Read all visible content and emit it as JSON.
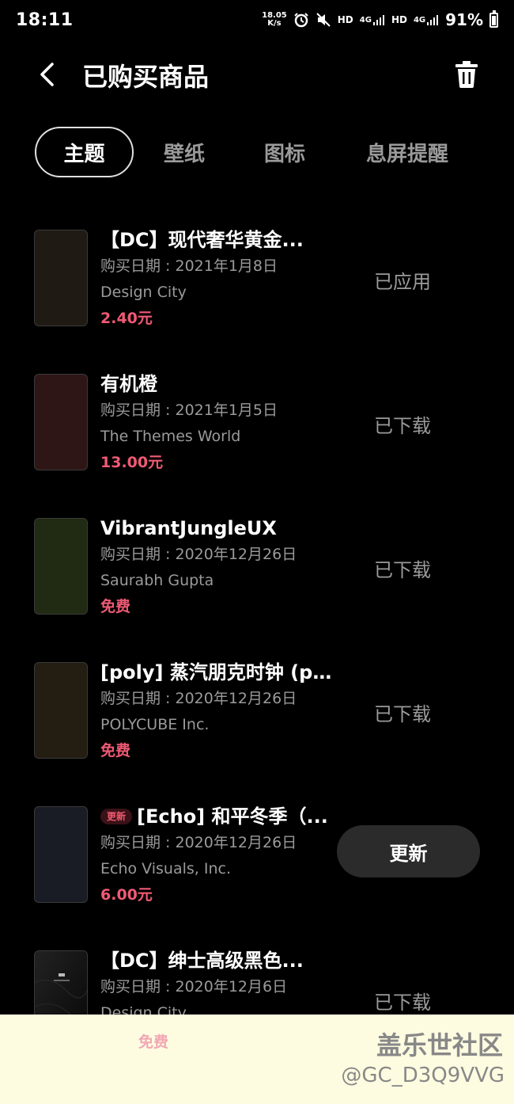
{
  "status_bar": {
    "time": "18:11",
    "speed_value": "18.05",
    "speed_unit": "K/s",
    "hd1": "HD",
    "net1": "4G",
    "hd2": "HD",
    "net2": "4G",
    "battery": "91%",
    "battery_level": 0.91
  },
  "header": {
    "title": "已购买商品"
  },
  "tabs": [
    {
      "label": "主题",
      "active": true
    },
    {
      "label": "壁纸",
      "active": false
    },
    {
      "label": "图标",
      "active": false
    },
    {
      "label": "息屏提醒",
      "active": false
    }
  ],
  "items": [
    {
      "title": "【DC】现代奢华黄金...",
      "date": "购买日期 : 2021年1月8日",
      "author": "Design City",
      "price": "2.40元",
      "status": "已应用",
      "thumb_color": "#201a14"
    },
    {
      "title": "有机橙",
      "date": "购买日期 : 2021年1月5日",
      "author": "The Themes World",
      "price": "13.00元",
      "status": "已下载",
      "thumb_color": "#2f1616"
    },
    {
      "title": "VibrantJungleUX",
      "date": "购买日期 : 2020年12月26日",
      "author": "Saurabh Gupta",
      "price": "免费",
      "status": "已下载",
      "thumb_color": "#212a12"
    },
    {
      "title": "[poly] 蒸汽朋克时钟 (pr...",
      "date": "购买日期 : 2020年12月26日",
      "author": "POLYCUBE Inc.",
      "price": "免费",
      "status": "已下载",
      "thumb_color": "#241d12"
    },
    {
      "badge": "更新",
      "title": "[Echo] 和平冬季（...",
      "date": "购买日期 : 2020年12月26日",
      "author": "Echo Visuals, Inc.",
      "price": "6.00元",
      "status": "更新",
      "thumb_color": "#191c24"
    },
    {
      "title": "【DC】绅士高级黑色...",
      "date": "购买日期 : 2020年12月6日",
      "author": "Design City",
      "price": "免费",
      "status": "已下载",
      "thumb_color": "#0e0e0e"
    }
  ],
  "watermark": {
    "title": "盖乐世社区",
    "user": "@GC_D3Q9VVG"
  }
}
